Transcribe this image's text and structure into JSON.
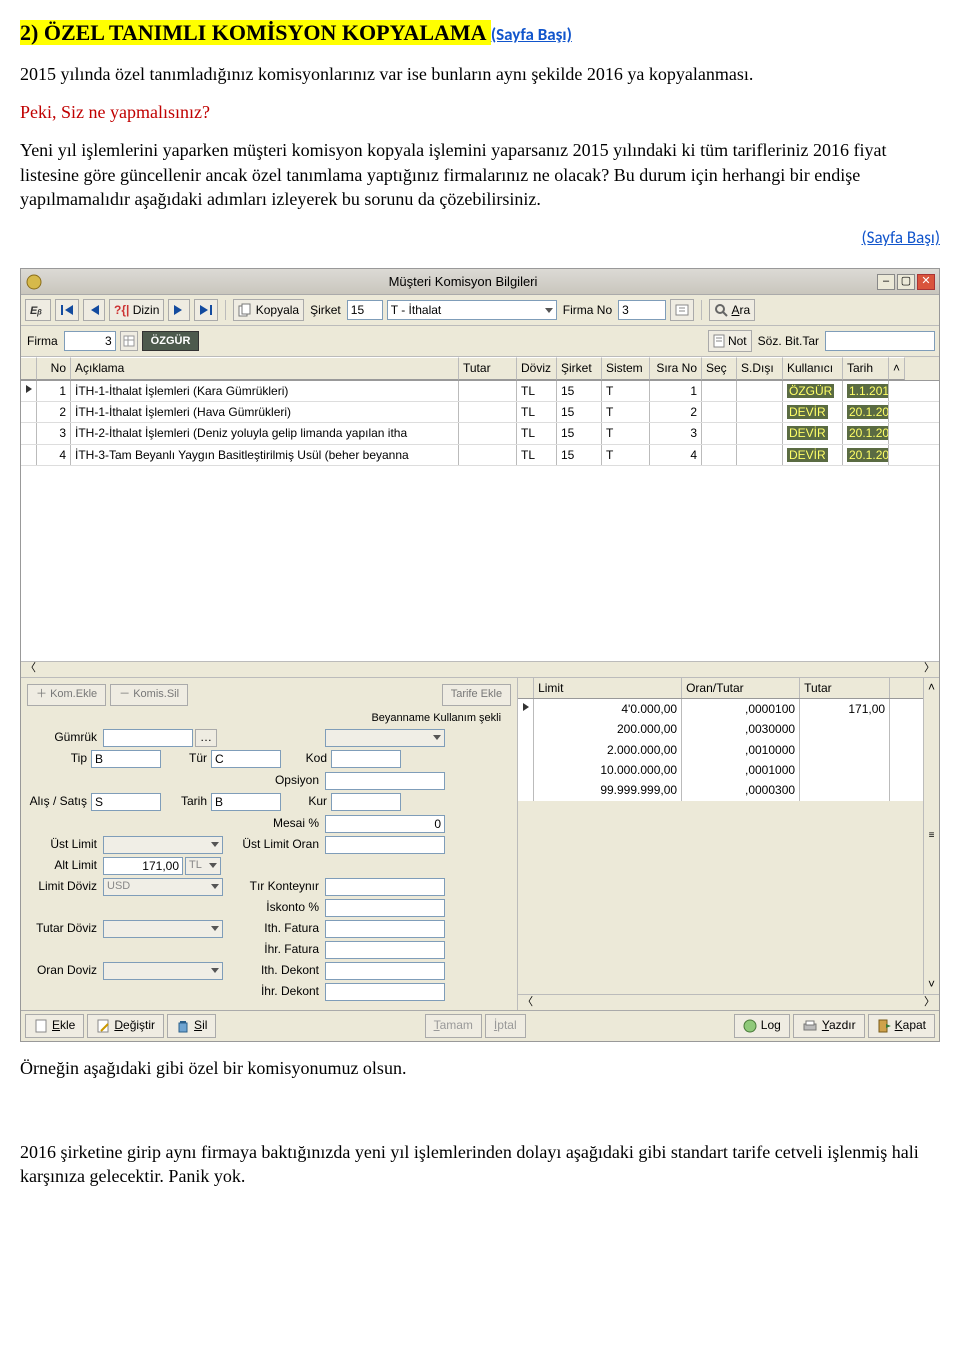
{
  "doc": {
    "heading_main": "2) ÖZEL TANIMLI KOMİSYON KOPYALAMA ",
    "heading_link": "(Sayfa Başı)",
    "p1": "2015 yılında özel tanımladığınız komisyonlarınız var ise bunların aynı şekilde 2016 ya kopyalanması.",
    "p2": "Peki, Siz ne yapmalısınız?",
    "p3": "Yeni yıl işlemlerini yaparken müşteri komisyon kopyala işlemini yaparsanız 2015 yılındaki ki tüm tarifleriniz 2016 fiyat listesine göre güncellenir ancak özel tanımlama yaptığınız firmalarınız ne olacak? Bu durum için herhangi bir endişe yapılmamalıdır aşağıdaki adımları izleyerek bu sorunu da çözebilirsiniz.",
    "right_link": "(Sayfa Başı)",
    "caption_below": "Örneğin aşağıdaki gibi özel bir komisyonumuz olsun.",
    "final_para": "2016 şirketine girip aynı firmaya baktığınızda yeni yıl işlemlerinden dolayı aşağıdaki gibi standart tarife cetveli işlenmiş hali karşınıza gelecektir. Panik yok."
  },
  "win": {
    "title": "Müşteri Komisyon Bilgileri",
    "toolbar": {
      "dizin": "Dizin",
      "kopyala": "Kopyala",
      "sirket_label": "Şirket",
      "sirket_val": "15",
      "sirket_type": "T - İthalat",
      "firma_no_label": "Firma No",
      "firma_no_val": "3",
      "ara": "Ara"
    },
    "row2": {
      "firma_label": "Firma",
      "firma_val": "3",
      "firma_name": "ÖZGÜR",
      "not": "Not",
      "sozbit": "Söz. Bit.Tar"
    },
    "grid": {
      "headers": [
        "No",
        "Açıklama",
        "Tutar",
        "Döviz",
        "Şirket",
        "Sistem",
        "Sıra No",
        "Seç",
        "S.Dışı",
        "Kullanıcı",
        "Tarih"
      ],
      "rows": [
        {
          "no": "1",
          "ac": "İTH-1-İthalat İşlemleri  (Kara Gümrükleri)",
          "tu": "",
          "dv": "TL",
          "sk": "15",
          "ss": "T",
          "sn": "1",
          "se": "",
          "sd": "",
          "ku": "ÖZGÜR",
          "ta": "1.1.201"
        },
        {
          "no": "2",
          "ac": "İTH-1-İthalat İşlemleri  (Hava Gümrükleri)",
          "tu": "",
          "dv": "TL",
          "sk": "15",
          "ss": "T",
          "sn": "2",
          "se": "",
          "sd": "",
          "ku": "DEVİR",
          "ta": "20.1.20"
        },
        {
          "no": "3",
          "ac": "İTH-2-İthalat İşlemleri (Deniz yoluyla gelip limanda yapılan itha",
          "tu": "",
          "dv": "TL",
          "sk": "15",
          "ss": "T",
          "sn": "3",
          "se": "",
          "sd": "",
          "ku": "DEVİR",
          "ta": "20.1.20"
        },
        {
          "no": "4",
          "ac": "İTH-3-Tam Beyanlı Yaygın Basitleştirilmiş Usül (beher beyanna",
          "tu": "",
          "dv": "TL",
          "sk": "15",
          "ss": "T",
          "sn": "4",
          "se": "",
          "sd": "",
          "ku": "DEVİR",
          "ta": "20.1.20"
        }
      ]
    },
    "left": {
      "kom_ekle": "Kom.Ekle",
      "komis_sil": "Komis.Sil",
      "tarife_ekle": "Tarife Ekle",
      "beyan_label": "Beyanname Kullanım şekli",
      "gumruk": "Gümrük",
      "tip": "Tip",
      "tip_v": "B",
      "tur": "Tür",
      "tur_v": "C",
      "kod": "Kod",
      "opsiyon": "Opsiyon",
      "alis": "Alış / Satış",
      "alis_v": "S",
      "tarih": "Tarih",
      "tarih_v": "B",
      "kur": "Kur",
      "mesai": "Mesai %",
      "mesai_v": "0",
      "ustlimit": "Üst Limit",
      "ustlimit_oran": "Üst Limit Oran",
      "altlimit": "Alt Limit",
      "altlimit_v": "171,00",
      "altlimit_cur": "TL",
      "limitdoviz": "Limit Döviz",
      "limitdoviz_v": "USD",
      "tirkont": "Tır Konteynır",
      "iskonto": "İskonto %",
      "tutardoviz": "Tutar Döviz",
      "ithfatura": "Ith. Fatura",
      "ihrfatura": "İhr. Fatura",
      "orandoviz": "Oran Doviz",
      "ithdekont": "Ith. Dekont",
      "ihrdekont": "İhr. Dekont"
    },
    "limits": {
      "headers": [
        "Limit",
        "Oran/Tutar",
        "Tutar"
      ],
      "rows": [
        {
          "lim": "4'0.000,00",
          "oran": ",0000100",
          "tut": "171,00"
        },
        {
          "lim": "200.000,00",
          "oran": ",0030000",
          "tut": ""
        },
        {
          "lim": "2.000.000,00",
          "oran": ",0010000",
          "tut": ""
        },
        {
          "lim": "10.000.000,00",
          "oran": ",0001000",
          "tut": ""
        },
        {
          "lim": "99.999.999,00",
          "oran": ",0000300",
          "tut": ""
        }
      ]
    },
    "footer": {
      "ekle": "Ekle",
      "degistir": "Değiştir",
      "sil": "Sil",
      "tamam": "Tamam",
      "iptal": "İptal",
      "log": "Log",
      "yazdir": "Yazdır",
      "kapat": "Kapat"
    }
  }
}
